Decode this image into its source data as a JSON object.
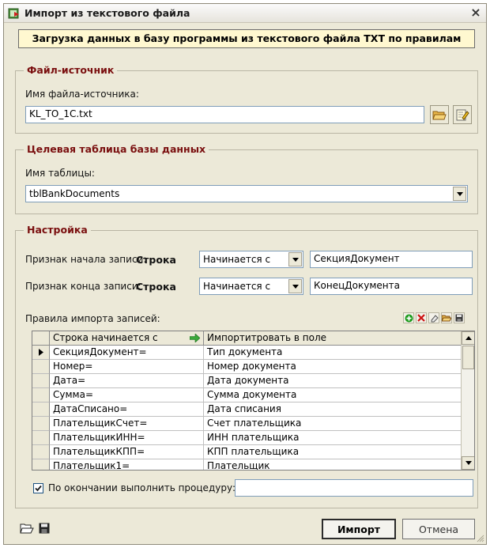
{
  "window": {
    "title": "Импорт из текстового файла",
    "close_glyph": "×"
  },
  "banner": "Загрузка данных в базу программы из текстового файла TXT по правилам",
  "source": {
    "legend": "Файл-источник",
    "label": "Имя файла-источника:",
    "value": "KL_TO_1C.txt"
  },
  "target": {
    "legend": "Целевая таблица базы данных",
    "label": "Имя таблицы:",
    "value": "tblBankDocuments"
  },
  "settings": {
    "legend": "Настройка",
    "start": {
      "label": "Признак начала записи:",
      "kind": "Строка",
      "mode": "Начинается с",
      "value": "СекцияДокумент"
    },
    "end": {
      "label": "Признак конца записи:",
      "kind": "Строка",
      "mode": "Начинается с",
      "value": "КонецДокумента"
    },
    "rules_label": "Правила импорта записей:",
    "grid": {
      "columns": [
        "Строка начинается с",
        "Импортитровать в поле"
      ],
      "rows": [
        [
          "СекцияДокумент=",
          "Тип документа"
        ],
        [
          "Номер=",
          "Номер документа"
        ],
        [
          "Дата=",
          "Дата документа"
        ],
        [
          "Сумма=",
          "Сумма документа"
        ],
        [
          "ДатаСписано=",
          "Дата списания"
        ],
        [
          "ПлательщикСчет=",
          "Счет плательщика"
        ],
        [
          "ПлательщикИНН=",
          "ИНН плательщика"
        ],
        [
          "ПлательщикКПП=",
          "КПП плательщика"
        ],
        [
          "Плательщик1=",
          "Плательщик"
        ]
      ],
      "current_row": 0
    },
    "procedure": {
      "checked": true,
      "label": "По окончании выполнить процедуру:",
      "value": ""
    }
  },
  "buttons": {
    "import": "Импорт",
    "cancel": "Отмена"
  },
  "colors": {
    "legend": "#7a0f0f",
    "banner": "#fff8d0",
    "add": "#1a9a1a",
    "delete": "#cc1111"
  }
}
